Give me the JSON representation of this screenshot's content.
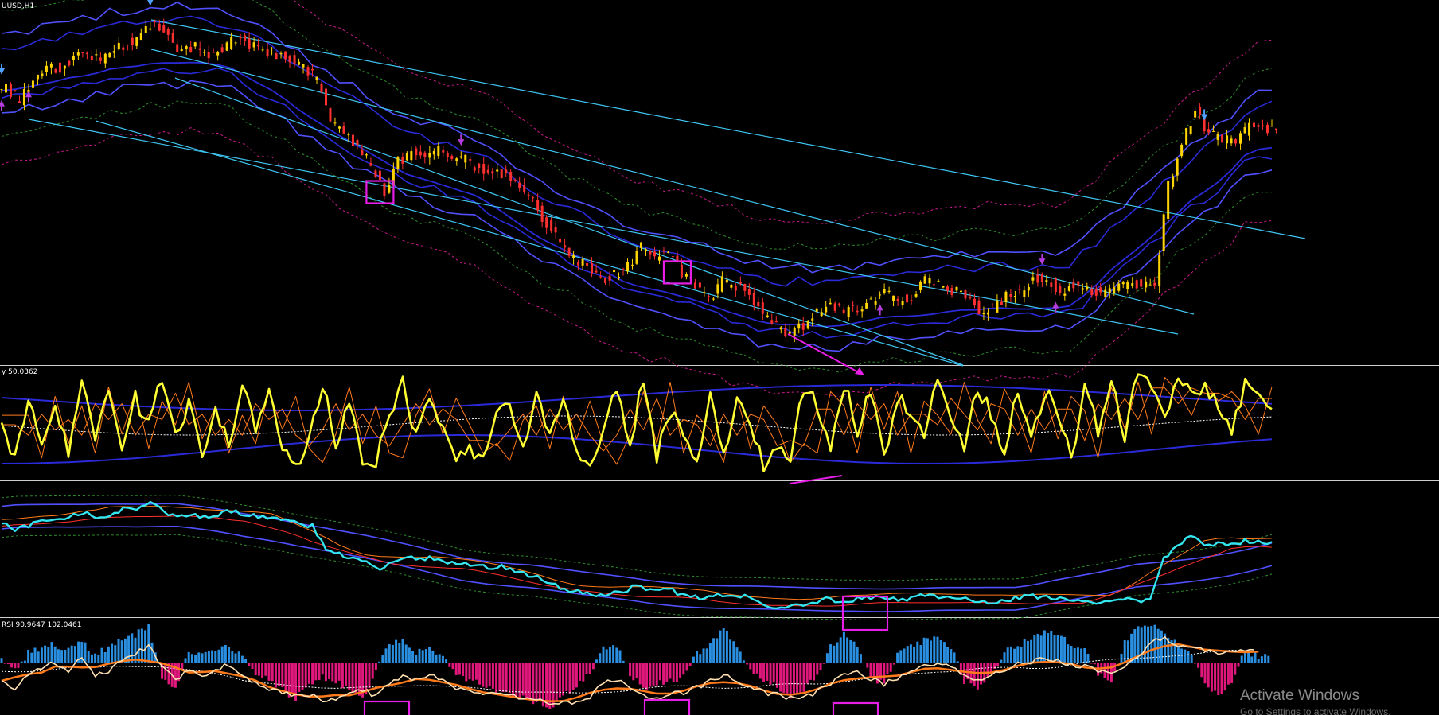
{
  "window": {
    "symbol_label": "UUSD,H1"
  },
  "panels": {
    "stoch_label": "y 50.0362",
    "rsi_label": "RSI 90.9647 102.0461"
  },
  "watermark": {
    "title": "Activate Windows",
    "subtitle": "Go to Settings to activate Windows."
  },
  "colors": {
    "background": "#000000",
    "bull_candle": "#ffd400",
    "bear_candle": "#ff3030",
    "channel": "#3fc6f2",
    "band": "#2a2ad8",
    "band_outer": "#5050ff",
    "dotted_pink": "#c81c8c",
    "dotted_green": "#2e8b2e",
    "stoch": "#ffff33",
    "stoch_signal": "#ff7a1a",
    "cyan_line": "#33e6f0",
    "rsi_line": "#ffe0b0",
    "hist_pos": "#2a8fe0",
    "hist_neg": "#e0187c",
    "marker": "#e61ee6",
    "arrow_down": "#b43cdc",
    "arrow_up": "#b43cdc",
    "arrow_blue": "#4fa0ff"
  },
  "chart_data": [
    {
      "type": "line",
      "panel": "price",
      "symbol": "UUSD,H1",
      "series": [
        {
          "values": [
            1.122,
            1.1195,
            1.124,
            1.127,
            1.1265,
            1.129,
            1.13,
            1.128,
            1.1305,
            1.132,
            1.1335,
            1.137,
            1.133,
            1.13,
            1.131,
            1.129,
            1.1305,
            1.133,
            1.1315,
            1.13,
            1.1295,
            1.129,
            1.127,
            1.124,
            1.115,
            1.112,
            1.11,
            1.105,
            1.0995,
            1.106,
            1.1085,
            1.1075,
            1.109,
            1.107,
            1.1065,
            1.1045,
            1.103,
            1.104,
            1.1005,
            1.0975,
            1.0925,
            1.088,
            1.085,
            1.0835,
            1.08,
            1.0815,
            1.0835,
            1.0875,
            1.0855,
            1.086,
            1.082,
            1.079,
            1.076,
            1.08,
            1.079,
            1.0775,
            1.073,
            1.07,
            1.069,
            1.0705,
            1.0735,
            1.0745,
            1.0735,
            1.0745,
            1.076,
            1.0775,
            1.0755,
            1.077,
            1.08,
            1.079,
            1.078,
            1.0775,
            1.074,
            1.074,
            1.077,
            1.0775,
            1.081,
            1.0805,
            1.078,
            1.0795,
            1.0785,
            1.0775,
            1.0785,
            1.08,
            1.079,
            1.079,
            1.101,
            1.11,
            1.117,
            1.112,
            1.111,
            1.11,
            1.114,
            1.1135,
            1.1135
          ]
        }
      ],
      "markers": [
        {
          "kind": "box",
          "index": 28
        },
        {
          "kind": "box",
          "index": 50
        },
        {
          "kind": "arrow-down",
          "index": 11
        },
        {
          "kind": "arrow-up",
          "index": 0
        },
        {
          "kind": "arrow-down",
          "index": 0
        },
        {
          "kind": "arrow-up",
          "index": 2
        },
        {
          "kind": "arrow-down",
          "index": 34
        },
        {
          "kind": "arrow-up",
          "index": 65
        },
        {
          "kind": "arrow-down",
          "index": 77
        },
        {
          "kind": "arrow-up",
          "index": 78
        },
        {
          "kind": "arrow-down",
          "index": 89
        }
      ]
    },
    {
      "type": "line",
      "panel": "stochastic",
      "ylim": [
        0,
        100
      ],
      "series": [
        {
          "values": [
            60,
            15,
            80,
            30,
            70,
            20,
            90,
            40,
            85,
            25,
            75,
            50,
            95,
            35,
            70,
            20,
            60,
            30,
            85,
            45,
            80,
            25,
            10,
            40,
            90,
            30,
            70,
            20,
            15,
            60,
            88,
            40,
            78,
            50,
            20,
            30,
            12,
            55,
            70,
            25,
            80,
            35,
            75,
            30,
            8,
            40,
            85,
            30,
            95,
            20,
            60,
            45,
            10,
            80,
            25,
            70,
            50,
            10,
            30,
            20,
            85,
            70,
            20,
            90,
            45,
            85,
            20,
            75,
            60,
            40,
            95,
            55,
            30,
            88,
            60,
            20,
            85,
            35,
            80,
            65,
            15,
            90,
            45,
            95,
            40,
            100,
            85,
            60,
            95,
            75,
            85,
            70,
            40,
            90,
            75,
            65
          ]
        },
        {
          "values": [
            50,
            40,
            60,
            45,
            55,
            40,
            70,
            55,
            70,
            40,
            60,
            55,
            80,
            50,
            60,
            40,
            55,
            40,
            70,
            55,
            65,
            40,
            30,
            45,
            70,
            45,
            60,
            40,
            30,
            50,
            70,
            50,
            65,
            55,
            35,
            35,
            30,
            45,
            60,
            40,
            65,
            45,
            60,
            40,
            25,
            40,
            65,
            45,
            75,
            40,
            55,
            50,
            30,
            60,
            40,
            60,
            55,
            30,
            35,
            30,
            65,
            65,
            40,
            70,
            55,
            70,
            40,
            60,
            60,
            50,
            75,
            60,
            45,
            70,
            65,
            40,
            65,
            45,
            65,
            65,
            35,
            70,
            55,
            75,
            55,
            85,
            85,
            70,
            85,
            80,
            80,
            75,
            55,
            75,
            75,
            70
          ]
        }
      ]
    },
    {
      "type": "line",
      "panel": "momentum",
      "series": [
        {
          "values": [
            65,
            60,
            62,
            68,
            66,
            70,
            72,
            68,
            70,
            74,
            75,
            80,
            72,
            70,
            71,
            69,
            70,
            73,
            71,
            69,
            68,
            67,
            65,
            62,
            45,
            42,
            40,
            36,
            30,
            38,
            40,
            38,
            40,
            37,
            36,
            34,
            33,
            34,
            30,
            28,
            24,
            20,
            17,
            15,
            12,
            14,
            16,
            20,
            18,
            19,
            15,
            13,
            10,
            14,
            13,
            12,
            8,
            5,
            4,
            6,
            9,
            10,
            9,
            10,
            11,
            12,
            10,
            11,
            14,
            13,
            12,
            11,
            8,
            8,
            10,
            11,
            13,
            12,
            10,
            11,
            10,
            9,
            10,
            11,
            10,
            10,
            40,
            48,
            55,
            50,
            49,
            48,
            52,
            51,
            51
          ]
        }
      ]
    },
    {
      "type": "bar",
      "panel": "rsi-histogram",
      "series": [
        {
          "values": [
            2,
            -4,
            5,
            8,
            10,
            6,
            12,
            4,
            8,
            12,
            15,
            20,
            -10,
            -15,
            6,
            4,
            8,
            10,
            2,
            -6,
            -10,
            -15,
            -20,
            -12,
            -8,
            -10,
            -15,
            -20,
            -5,
            10,
            12,
            5,
            8,
            2,
            -5,
            -10,
            -12,
            -15,
            -18,
            -20,
            -22,
            -25,
            -18,
            -12,
            -5,
            8,
            10,
            -6,
            -15,
            -12,
            -10,
            -8,
            5,
            10,
            18,
            8,
            -5,
            -10,
            -12,
            -20,
            -15,
            -6,
            8,
            15,
            10,
            -8,
            -12,
            4,
            10,
            12,
            15,
            8,
            -10,
            -14,
            -8,
            6,
            10,
            12,
            18,
            15,
            10,
            8,
            -6,
            -10,
            12,
            18,
            20,
            15,
            10,
            5,
            -12,
            -18,
            -10,
            6,
            4,
            2
          ]
        },
        {
          "values": [
            40,
            30,
            45,
            55,
            60,
            50,
            65,
            45,
            50,
            62,
            70,
            80,
            55,
            40,
            50,
            45,
            50,
            58,
            45,
            35,
            30,
            25,
            20,
            22,
            15,
            18,
            25,
            28,
            20,
            35,
            42,
            40,
            45,
            40,
            30,
            28,
            25,
            22,
            20,
            18,
            15,
            12,
            12,
            14,
            20,
            35,
            40,
            30,
            22,
            18,
            22,
            25,
            30,
            38,
            45,
            40,
            30,
            25,
            22,
            18,
            20,
            25,
            35,
            45,
            50,
            40,
            35,
            42,
            50,
            55,
            60,
            55,
            45,
            40,
            45,
            52,
            58,
            60,
            65,
            62,
            58,
            55,
            50,
            45,
            55,
            65,
            85,
            88,
            80,
            78,
            75,
            70,
            72,
            74,
            72
          ]
        }
      ]
    }
  ]
}
